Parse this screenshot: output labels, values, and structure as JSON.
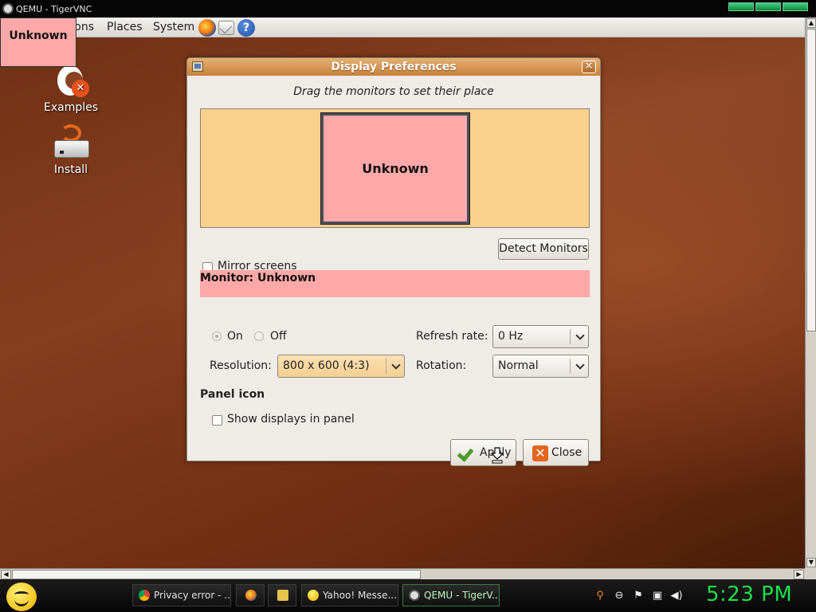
{
  "vnc": {
    "title": "QEMU - TigerVNC"
  },
  "panel": {
    "applications_label": "Applications",
    "places_label": "Places",
    "system_label": "System"
  },
  "overlay": {
    "label": "Unknown"
  },
  "desktop_icons": [
    {
      "label": "Examples",
      "icon": "examples-icon"
    },
    {
      "label": "Install",
      "icon": "install-icon"
    }
  ],
  "dialog": {
    "title": "Display Preferences",
    "instruction": "Drag the monitors to set their place",
    "monitor_box_label": "Unknown",
    "mirror_screens_label": "Mirror screens",
    "mirror_screens_checked": false,
    "detect_button": "Detect Monitors",
    "monitor_header": "Monitor: Unknown",
    "on_label": "On",
    "off_label": "Off",
    "power_state": "On",
    "refresh_label": "Refresh rate:",
    "refresh_value": "0 Hz",
    "resolution_label": "Resolution:",
    "resolution_value": "800 x 600 (4:3)",
    "rotation_label": "Rotation:",
    "rotation_value": "Normal",
    "panel_icon_title": "Panel icon",
    "show_displays_label": "Show displays in panel",
    "show_displays_checked": false,
    "apply_button": "Apply",
    "close_button": "Close",
    "monitor_color": "#ffa8a8",
    "arrange_bg_color": "#fad18c",
    "titlebar_color": "#c8813a"
  },
  "taskbar": {
    "tasks": [
      {
        "label": "Privacy error - ...",
        "icon": "chrome-icon"
      },
      {
        "label": "Yahoo! Messe...",
        "icon": "yahoo-messenger-icon"
      },
      {
        "label": "QEMU - TigerV...",
        "icon": "tigervnc-icon",
        "active": true
      }
    ],
    "quick_launch": [
      "firefox-icon",
      "folder-icon"
    ],
    "tray_icons": [
      "search-icon",
      "status-icon",
      "flag-icon",
      "network-icon",
      "volume-icon"
    ],
    "clock": "5:23 PM",
    "clock_color": "#19e04a"
  }
}
